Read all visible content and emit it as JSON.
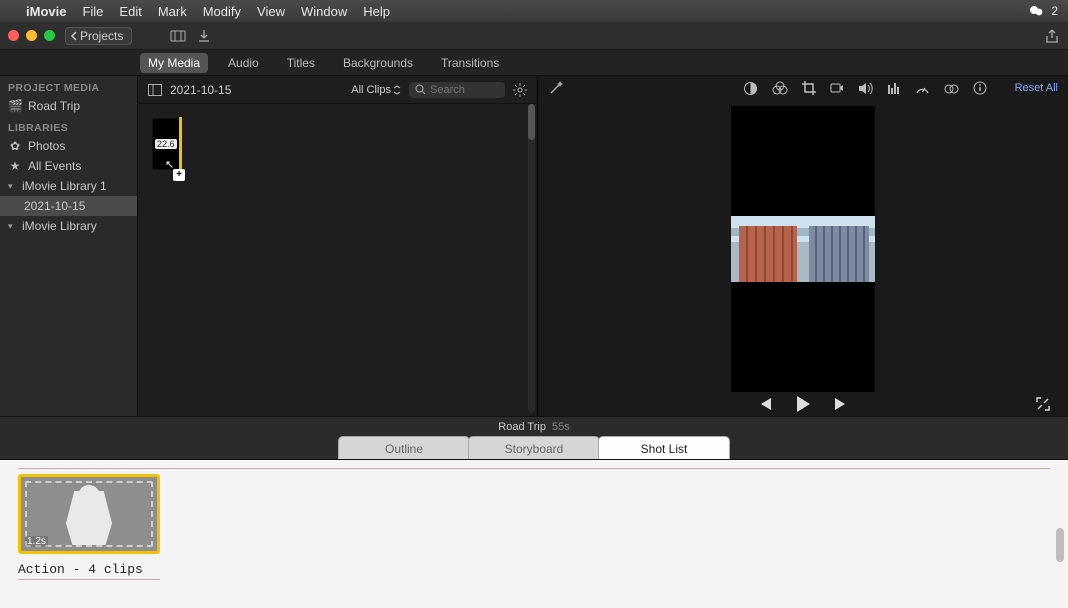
{
  "menubar": {
    "app": "iMovie",
    "items": [
      "File",
      "Edit",
      "Mark",
      "Modify",
      "View",
      "Window",
      "Help"
    ],
    "right_badge": "2"
  },
  "titlebar": {
    "back_label": "Projects"
  },
  "mediatabs": {
    "items": [
      "My Media",
      "Audio",
      "Titles",
      "Backgrounds",
      "Transitions"
    ],
    "active_index": 0
  },
  "sidebar": {
    "section_project": "PROJECT MEDIA",
    "project_name": "Road Trip",
    "section_libraries": "LIBRARIES",
    "photos": "Photos",
    "all_events": "All Events",
    "lib1": "iMovie Library 1",
    "lib1_event": "2021-10-15",
    "lib2": "iMovie Library"
  },
  "browser": {
    "event_title": "2021-10-15",
    "filter": "All Clips",
    "search_placeholder": "Search",
    "clip_time": "22.6"
  },
  "viewer": {
    "reset_label": "Reset All",
    "frame_caption": ""
  },
  "project": {
    "title": "Road Trip",
    "duration": "55s",
    "tabs": [
      "Outline",
      "Storyboard",
      "Shot List"
    ],
    "active_tab": 2,
    "shot_duration": "1.2s",
    "shot_caption": "Action - 4 clips"
  }
}
